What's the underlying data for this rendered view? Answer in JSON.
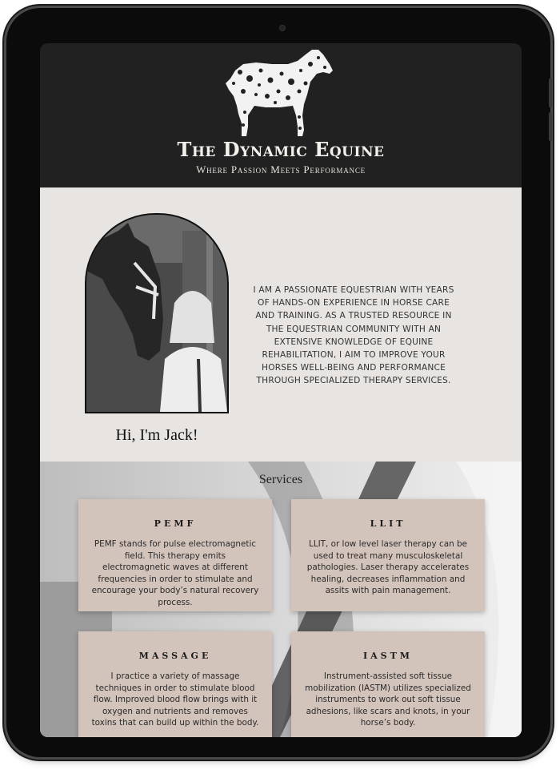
{
  "brand": {
    "title": "The Dynamic Equine",
    "tagline": "Where Passion Meets Performance"
  },
  "about": {
    "greeting": "Hi, I'm Jack!",
    "bio": "I am a passionate equestrian with years of hands-on experience in horse care and training. As a trusted resource in the equestrian community with an extensive knowledge of equine rehabilitation, I aim to improve your horses well-being and performance through specialized therapy services."
  },
  "services": {
    "title": "Services",
    "items": [
      {
        "title": "PEMF",
        "description": "PEMF stands for pulse electromagnetic field. This therapy emits electromagnetic waves at different frequencies in order to stimulate and encourage your body’s natural recovery process."
      },
      {
        "title": "LLIT",
        "description": "LLIT, or low level laser therapy can be used to treat many musculoskeletal pathologies. Laser therapy accelerates healing, decreases inflammation and assits with pain management."
      },
      {
        "title": "MASSAGE",
        "description": "I practice a variety of massage techniques in order to stimulate blood flow. Improved blood flow brings with it oxygen and nutrients and removes toxins that can build up within the body."
      },
      {
        "title": "IASTM",
        "description": "Instrument-assisted soft tissue mobilization (IASTM) utilizes specialized instruments to work out soft tissue adhesions, like scars and knots, in your horse’s body."
      }
    ]
  },
  "colors": {
    "header_bg": "#212121",
    "about_bg": "#e8e4e1",
    "card_bg": "#d3c4bb",
    "frame": "#0b0b0b"
  },
  "icons": [
    "horse-logo-icon",
    "camera-icon"
  ]
}
